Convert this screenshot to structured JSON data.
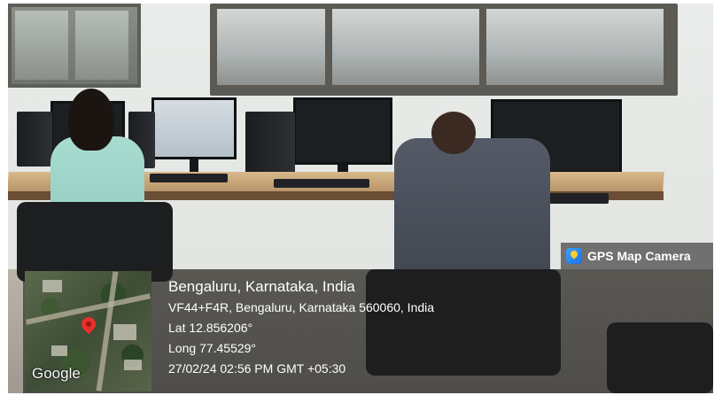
{
  "overlay": {
    "app_badge": {
      "label": "GPS Map Camera",
      "icon": "gps-map-camera-icon",
      "accent": "#1d6fe0"
    },
    "location": {
      "title": "Bengaluru, Karnataka, India",
      "address": "VF44+F4R, Bengaluru, Karnataka 560060, India",
      "lat": "Lat 12.856206°",
      "long": "Long 77.45529°",
      "timestamp": "27/02/24 02:56 PM GMT +05:30"
    },
    "map": {
      "brand": "Google",
      "pin_icon": "map-pin-icon",
      "pin_color": "#e5302d"
    }
  }
}
